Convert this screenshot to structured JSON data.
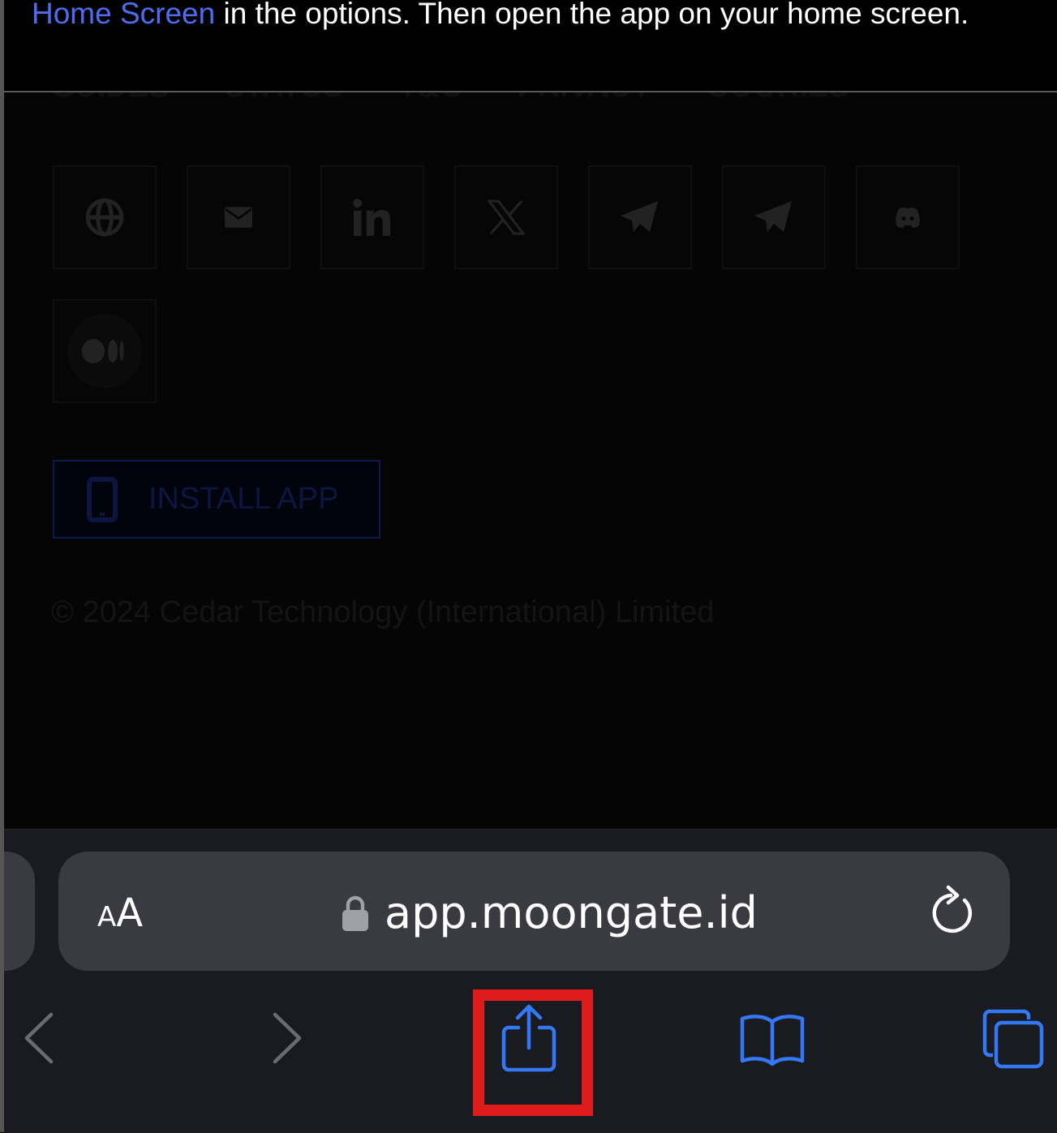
{
  "instruction": {
    "highlight": "Home Screen",
    "text": " in the options. Then open the app on your home screen."
  },
  "page": {
    "footer_links": [
      "GUIDES",
      "STATUS",
      "T&C",
      "PRIVACY",
      "COOKIES"
    ],
    "social_icons": [
      "globe-icon",
      "mail-icon",
      "linkedin-icon",
      "x-icon",
      "telegram-icon",
      "telegram-icon",
      "discord-icon",
      "medium-icon"
    ],
    "install_label": "INSTALL APP",
    "copyright": "© 2024 Cedar Technology (International) Limited"
  },
  "browser": {
    "aa_small": "A",
    "aa_large": "A",
    "url": "app.moongate.id"
  },
  "colors": {
    "accent": "#3478f6",
    "highlight_box": "#e01b1b",
    "link": "#4d6cf0"
  }
}
